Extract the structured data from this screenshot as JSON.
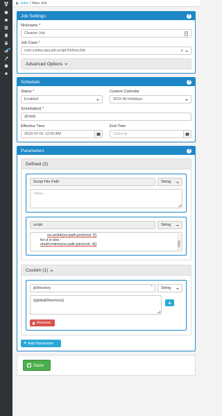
{
  "sidebar": {
    "logo": "ᐁ",
    "items": [
      {
        "icon": "gear-icon"
      },
      {
        "icon": "cog-icon"
      },
      {
        "icon": "list-icon"
      },
      {
        "icon": "document-icon"
      },
      {
        "icon": "lock-icon"
      },
      {
        "icon": "chart-icon",
        "badge": true
      },
      {
        "icon": "wrench-icon"
      },
      {
        "icon": "info-icon"
      },
      {
        "icon": "settings-icon"
      }
    ]
  },
  "breadcrumb": {
    "home_icon": "home-icon",
    "jobs_link": "Jobs",
    "separator": "/",
    "current": "New Job"
  },
  "job_settings": {
    "title": "Job Settings",
    "help": "?",
    "nickname_label": "Nickname *",
    "nickname_value": "Cleaner Job",
    "job_class_label": "Job Class *",
    "job_class_value": "com.carfey.ops.job.script.PythonJob",
    "job_class_clear": "×",
    "advanced_label": "Advanced Options"
  },
  "schedule": {
    "title": "Schedule",
    "help": "?",
    "status_label": "Status *",
    "status_value": "Enabled",
    "calendar_label": "Custom Calendar",
    "calendar_value": "2016 All Holidays",
    "schedules_label": "Schedule(s) *",
    "schedules_value": "@daily",
    "effective_label": "Effective Time",
    "effective_value": "2016-07-01 12:00 AM",
    "end_label": "End Time",
    "end_placeholder": "Optional"
  },
  "parameters": {
    "title": "Parameters",
    "help": "?",
    "defined_label": "Defined (2)",
    "defined": [
      {
        "name": "Script File Path",
        "type": "String",
        "value_placeholder": "Value..."
      },
      {
        "name": "script",
        "type": "String",
        "code": [
          "os.unlink(os.path.join(root, f))",
          "for d in dirs:",
          "shutil.rmtree(os.path.join(root, d))"
        ]
      }
    ],
    "custom_label": "Custom (1)",
    "custom": [
      {
        "name": "pDirectory",
        "required_mark": "*",
        "type": "String",
        "value": "{{globalDirectory}}"
      }
    ],
    "plus_label": "+",
    "remove_label": "Remove",
    "add_param_label": "Add Parameter"
  },
  "save": {
    "label": "Save"
  },
  "colors": {
    "primary": "#1e88c7",
    "info": "#2aa9d8",
    "success": "#4cae4c",
    "danger": "#d9534f",
    "sidebar": "#2f3337"
  }
}
